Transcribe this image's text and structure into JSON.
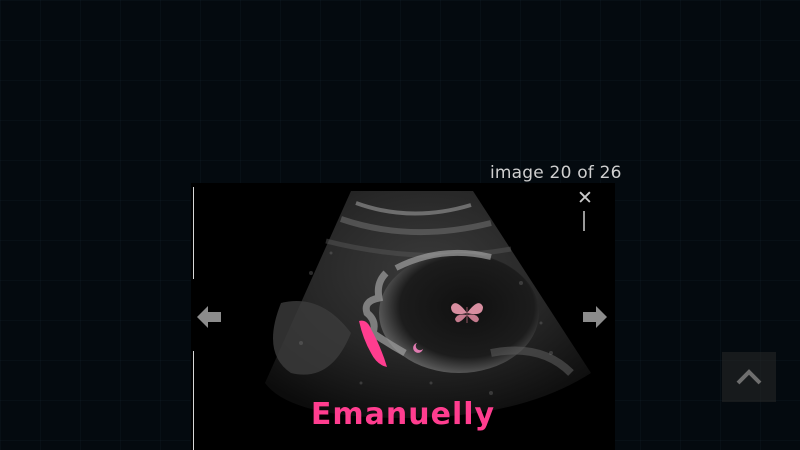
{
  "viewer": {
    "counter_text": "image 20 of 26",
    "caption": "Emanuelly",
    "close_glyph": "✕"
  },
  "icons": {
    "close": "close-icon",
    "prev": "arrow-left-icon",
    "next": "arrow-right-icon",
    "back_to_top": "chevron-up-icon",
    "butterfly": "butterfly-icon",
    "bow": "ribbon-icon"
  },
  "colors": {
    "background": "#040a0f",
    "caption": "#ff3d8f",
    "butterfly": "#d88ea0",
    "arrow": "#8c8c8c"
  }
}
